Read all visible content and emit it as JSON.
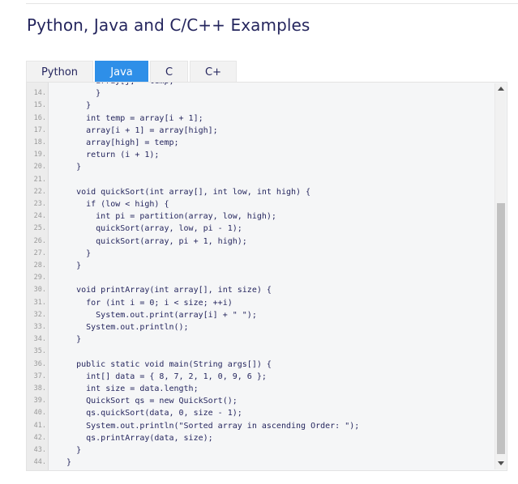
{
  "page": {
    "heading": "Python, Java and C/C++ Examples"
  },
  "tabs": [
    {
      "label": "Python",
      "active": false
    },
    {
      "label": "Java",
      "active": true
    },
    {
      "label": "C",
      "active": false
    },
    {
      "label": "C+",
      "active": false
    }
  ],
  "code": {
    "lines": [
      {
        "n": "",
        "text": "        array[j] = temp;"
      },
      {
        "n": "14.",
        "text": "        }"
      },
      {
        "n": "15.",
        "text": "      }"
      },
      {
        "n": "16.",
        "text": "      int temp = array[i + 1];"
      },
      {
        "n": "17.",
        "text": "      array[i + 1] = array[high];"
      },
      {
        "n": "18.",
        "text": "      array[high] = temp;"
      },
      {
        "n": "19.",
        "text": "      return (i + 1);"
      },
      {
        "n": "20.",
        "text": "    }"
      },
      {
        "n": "21.",
        "text": ""
      },
      {
        "n": "22.",
        "text": "    void quickSort(int array[], int low, int high) {"
      },
      {
        "n": "23.",
        "text": "      if (low < high) {"
      },
      {
        "n": "24.",
        "text": "        int pi = partition(array, low, high);"
      },
      {
        "n": "25.",
        "text": "        quickSort(array, low, pi - 1);"
      },
      {
        "n": "26.",
        "text": "        quickSort(array, pi + 1, high);"
      },
      {
        "n": "27.",
        "text": "      }"
      },
      {
        "n": "28.",
        "text": "    }"
      },
      {
        "n": "29.",
        "text": ""
      },
      {
        "n": "30.",
        "text": "    void printArray(int array[], int size) {"
      },
      {
        "n": "31.",
        "text": "      for (int i = 0; i < size; ++i)"
      },
      {
        "n": "32.",
        "text": "        System.out.print(array[i] + \" \");"
      },
      {
        "n": "33.",
        "text": "      System.out.println();"
      },
      {
        "n": "34.",
        "text": "    }"
      },
      {
        "n": "35.",
        "text": ""
      },
      {
        "n": "36.",
        "text": "    public static void main(String args[]) {"
      },
      {
        "n": "37.",
        "text": "      int[] data = { 8, 7, 2, 1, 0, 9, 6 };"
      },
      {
        "n": "38.",
        "text": "      int size = data.length;"
      },
      {
        "n": "39.",
        "text": "      QuickSort qs = new QuickSort();"
      },
      {
        "n": "40.",
        "text": "      qs.quickSort(data, 0, size - 1);"
      },
      {
        "n": "41.",
        "text": "      System.out.println(\"Sorted array in ascending Order: \");"
      },
      {
        "n": "42.",
        "text": "      qs.printArray(data, size);"
      },
      {
        "n": "43.",
        "text": "    }"
      },
      {
        "n": "44.",
        "text": "  }"
      }
    ]
  },
  "colors": {
    "accent": "#2e8fe8",
    "text": "#25265e",
    "code_background": "#f5f6f7"
  },
  "icons": {
    "scroll_up": "triangle-up",
    "scroll_down": "triangle-down"
  }
}
